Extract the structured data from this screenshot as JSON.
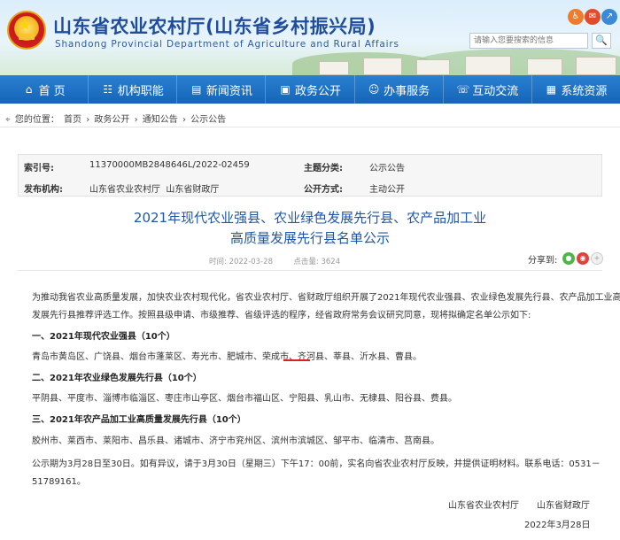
{
  "site": {
    "title": "山东省农业农村厅(山东省乡村振兴局)",
    "subtitle": "Shandong Provincial Department of Agriculture and Rural Affairs",
    "search_placeholder": "请输入您要搜索的信息",
    "search_button": "🔍"
  },
  "nav": [
    {
      "icon": "home-icon",
      "glyph": "⌂",
      "label": "首 页"
    },
    {
      "icon": "org-icon",
      "glyph": "☷",
      "label": "机构职能"
    },
    {
      "icon": "news-icon",
      "glyph": "▤",
      "label": "新闻资讯"
    },
    {
      "icon": "gov-icon",
      "glyph": "▣",
      "label": "政务公开"
    },
    {
      "icon": "service-icon",
      "glyph": "☺",
      "label": "办事服务"
    },
    {
      "icon": "interact-icon",
      "glyph": "☏",
      "label": "互动交流"
    },
    {
      "icon": "system-icon",
      "glyph": "▦",
      "label": "系统资源"
    }
  ],
  "breadcrumb": {
    "prefix": "您的位置：",
    "items": [
      "首页",
      "政务公开",
      "通知公告",
      "公示公告"
    ],
    "separator": "›"
  },
  "meta": {
    "index_label": "索引号:",
    "index_value": "11370000MB2848646L/2022-02459",
    "category_label": "主题分类:",
    "category_value": "公示公告",
    "publisher_label": "发布机构:",
    "publisher_value": "山东省农业农村厅  山东省财政厅",
    "openness_label": "公开方式:",
    "openness_value": "主动公开"
  },
  "article": {
    "title_line1": "2021年现代农业强县、农业绿色发展先行县、农产品加工业",
    "title_line2": "高质量发展先行县名单公示",
    "time_label": "时间: ",
    "time_value": "2022-03-28",
    "views_label": "点击量: ",
    "views_value": "3624",
    "share_label": "分享到:",
    "intro_line1": "为推动我省农业高质量发展，加快农业农村现代化，省农业农村厅、省财政厅组织开展了2021年现代农业强县、农业绿色发展先行县、农产品加工业高质量",
    "intro_line2": "发展先行县推荐评选工作。按照县级申请、市级推荐、省级评选的程序，经省政府常务会议研究同意，现将拟确定名单公示如下:",
    "section1_heading": "一、2021年现代农业强县（10个）",
    "section1_list": "青岛市黄岛区、广饶县、烟台市蓬莱区、寿光市、肥城市、荣成市、齐河县、莘县、沂水县、曹县。",
    "section2_heading": "二、2021年农业绿色发展先行县（10个）",
    "section2_list": "平阴县、平度市、淄博市临淄区、枣庄市山亭区、烟台市福山区、宁阳县、乳山市、无棣县、阳谷县、费县。",
    "section3_heading": "三、2021年农产品加工业高质量发展先行县（10个）",
    "section3_list": "胶州市、莱西市、莱阳市、昌乐县、诸城市、济宁市兖州区、滨州市滨城区、邹平市、临清市、莒南县。",
    "notice_line1": "公示期为3月28日至30日。如有异议，请于3月30日（星期三）下午17：00前，实名向省农业农村厅反映，并提供证明材料。联系电话：0531－",
    "notice_line2": "51789161。",
    "signature": "山东省农业农村厅　　山东省财政厅",
    "date": "2022年3月28日"
  },
  "colors": {
    "brand_blue": "#1f4d9b",
    "nav_blue": "#1565b8",
    "underline_red": "#e02020"
  }
}
